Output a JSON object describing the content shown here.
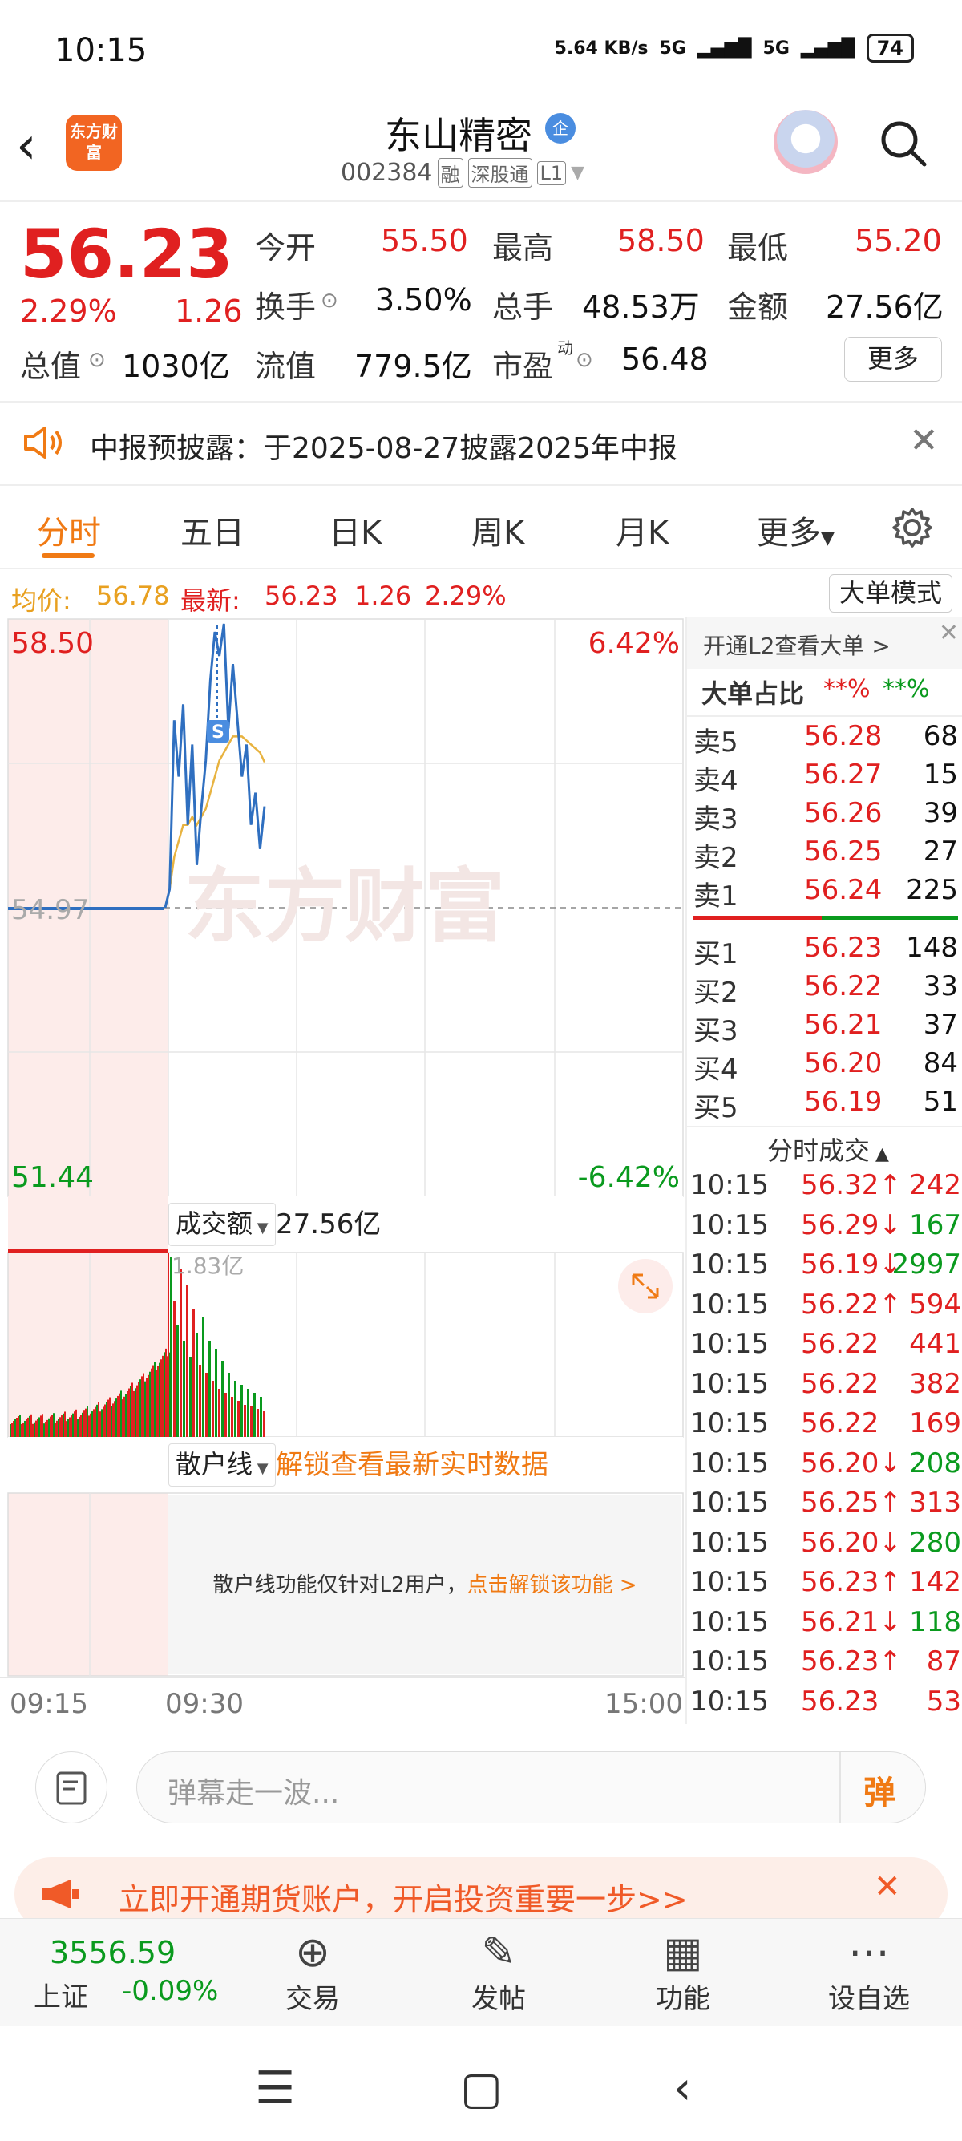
{
  "status_bar": {
    "time": "10:15",
    "speed": "5.64 KB/s",
    "net1": "5G",
    "net2": "5G",
    "battery": "74"
  },
  "header": {
    "back": "<",
    "logo_text": "东方财富",
    "stock_name": "东山精密",
    "qi_badge": "企",
    "code": "002384",
    "tags": [
      "融",
      "深股通",
      "L1"
    ]
  },
  "quote": {
    "price": "56.23",
    "change_pct": "2.29%",
    "change": "1.26",
    "open_label": "今开",
    "open": "55.50",
    "high_label": "最高",
    "high": "58.50",
    "low_label": "最低",
    "low": "55.20",
    "turnover_label": "换手",
    "turnover": "3.50%",
    "volume_label": "总手",
    "volume": "48.53万",
    "amount_label": "金额",
    "amount": "27.56亿",
    "mktcap_label": "总值",
    "mktcap": "1030亿",
    "float_label": "流值",
    "float_cap": "779.5亿",
    "pe_label": "市盈",
    "pe_sup": "动",
    "pe": "56.48",
    "more": "更多"
  },
  "notice": {
    "text": "中报预披露：于2025-08-27披露2025年中报"
  },
  "tabs": [
    "分时",
    "五日",
    "日K",
    "周K",
    "月K",
    "更多"
  ],
  "avg_line": {
    "avg_label": "均价:",
    "avg": "56.78",
    "latest_label": "最新:",
    "latest": "56.23",
    "chg": "1.26",
    "pct": "2.29%",
    "big_mode": "大单模式"
  },
  "chart": {
    "y_high": "58.50",
    "y_mid": "54.97",
    "y_low": "51.44",
    "pct_high": "6.42%",
    "pct_low": "-6.42%",
    "watermark": "东方财富",
    "s_marker": "S",
    "vol_label": "成交额",
    "vol_value": "27.56亿",
    "vol_max": "1.83亿",
    "retail_label": "散户线",
    "retail_unlock": "解锁查看最新实时数据",
    "retail_msg": "散户线功能仅针对L2用户，",
    "retail_link": "点击解锁该功能 >",
    "time_labels": [
      "09:15",
      "09:30",
      "15:00"
    ]
  },
  "chart_data": {
    "type": "line",
    "title": "",
    "series": [
      {
        "name": "",
        "values": [
          54.97,
          55.2,
          57.3,
          56.6,
          57.5,
          56.0,
          57.0,
          55.5,
          56.2,
          56.8,
          57.8,
          58.4,
          58.1,
          58.5,
          57.2,
          58.0,
          57.3,
          56.6,
          57.0,
          56.0,
          56.4,
          55.7,
          56.23
        ]
      },
      {
        "name": "",
        "values": [
          54.97,
          55.2,
          55.6,
          55.8,
          56.0,
          56.0,
          56.1,
          56.0,
          56.1,
          56.2,
          56.4,
          56.6,
          56.8,
          56.9,
          57.0,
          57.1,
          57.1,
          57.1,
          57.05,
          57.0,
          56.95,
          56.9,
          56.78
        ]
      }
    ],
    "ylim": [
      51.44,
      58.5
    ],
    "x_ticks": [
      "09:15",
      "09:30",
      "15:00"
    ]
  },
  "order_book": {
    "banner": "开通L2查看大单 >",
    "ratio_label": "大单占比",
    "ratio_red": "**%",
    "ratio_green": "**%",
    "asks": [
      {
        "name": "卖5",
        "price": "56.28",
        "vol": "68"
      },
      {
        "name": "卖4",
        "price": "56.27",
        "vol": "15"
      },
      {
        "name": "卖3",
        "price": "56.26",
        "vol": "39"
      },
      {
        "name": "卖2",
        "price": "56.25",
        "vol": "27"
      },
      {
        "name": "卖1",
        "price": "56.24",
        "vol": "225"
      }
    ],
    "bids": [
      {
        "name": "买1",
        "price": "56.23",
        "vol": "148"
      },
      {
        "name": "买2",
        "price": "56.22",
        "vol": "33"
      },
      {
        "name": "买3",
        "price": "56.21",
        "vol": "37"
      },
      {
        "name": "买4",
        "price": "56.20",
        "vol": "84"
      },
      {
        "name": "买5",
        "price": "56.19",
        "vol": "51"
      }
    ],
    "trades_label": "分时成交",
    "trades": [
      {
        "t": "10:15",
        "p": "56.32↑",
        "v": "242",
        "dir": "up"
      },
      {
        "t": "10:15",
        "p": "56.29↓",
        "v": "167",
        "dir": "down"
      },
      {
        "t": "10:15",
        "p": "56.19↓",
        "v": "2997",
        "dir": "down"
      },
      {
        "t": "10:15",
        "p": "56.22↑",
        "v": "594",
        "dir": "up"
      },
      {
        "t": "10:15",
        "p": "56.22",
        "v": "441",
        "dir": "flat"
      },
      {
        "t": "10:15",
        "p": "56.22",
        "v": "382",
        "dir": "flat"
      },
      {
        "t": "10:15",
        "p": "56.22",
        "v": "169",
        "dir": "flat"
      },
      {
        "t": "10:15",
        "p": "56.20↓",
        "v": "208",
        "dir": "down"
      },
      {
        "t": "10:15",
        "p": "56.25↑",
        "v": "313",
        "dir": "up"
      },
      {
        "t": "10:15",
        "p": "56.20↓",
        "v": "280",
        "dir": "down"
      },
      {
        "t": "10:15",
        "p": "56.23↑",
        "v": "142",
        "dir": "up"
      },
      {
        "t": "10:15",
        "p": "56.21↓",
        "v": "118",
        "dir": "down"
      },
      {
        "t": "10:15",
        "p": "56.23↑",
        "v": "87",
        "dir": "up"
      },
      {
        "t": "10:15",
        "p": "56.23",
        "v": "53",
        "dir": "flat"
      }
    ]
  },
  "comment": {
    "placeholder": "弹幕走一波...",
    "danmu_btn": "弹"
  },
  "promo": {
    "text": "立即开通期货账户，开启投资重要一步>>"
  },
  "nav": {
    "index_value": "3556.59",
    "index_name": "上证",
    "index_pct": "-0.09%",
    "items": [
      {
        "label": "交易",
        "icon": "yen-icon"
      },
      {
        "label": "发帖",
        "icon": "edit-icon"
      },
      {
        "label": "功能",
        "icon": "grid-icon"
      },
      {
        "label": "设自选",
        "icon": "more-icon"
      }
    ]
  },
  "colors": {
    "up": "#e02020",
    "down": "#0a9a1e",
    "accent": "#f07a14",
    "line": "#2f6fc0",
    "avg": "#e8b340"
  }
}
